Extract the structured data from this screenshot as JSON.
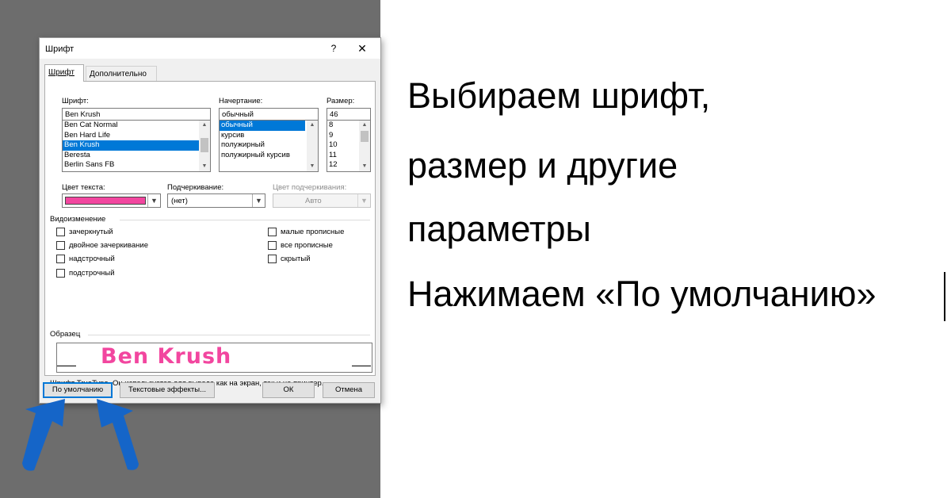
{
  "dialog": {
    "title": "Шрифт",
    "help": "?",
    "close": "✕",
    "tabs": [
      "Шрифт",
      "Дополнительно"
    ],
    "font": {
      "label": "Шрифт:",
      "value": "Ben Krush",
      "list": [
        "Ben Cat Normal",
        "Ben Hard Life",
        "Ben Krush",
        "Beresta",
        "Berlin Sans FB"
      ],
      "selected": "Ben Krush"
    },
    "style": {
      "label": "Начертание:",
      "value": "обычный",
      "list": [
        "обычный",
        "курсив",
        "полужирный",
        "полужирный курсив"
      ],
      "selected": "обычный"
    },
    "size": {
      "label": "Размер:",
      "value": "46",
      "list": [
        "8",
        "9",
        "10",
        "11",
        "12"
      ]
    },
    "text_color": {
      "label": "Цвет текста:",
      "color": "#f2469f"
    },
    "underline": {
      "label": "Подчеркивание:",
      "value": "(нет)"
    },
    "underline_color": {
      "label": "Цвет подчеркивания:",
      "value": "Авто"
    },
    "effects": {
      "label": "Видоизменение",
      "left": [
        "зачеркнутый",
        "двойное зачеркивание",
        "надстрочный",
        "подстрочный"
      ],
      "right": [
        "малые прописные",
        "все прописные",
        "скрытый"
      ]
    },
    "preview": {
      "label": "Образец",
      "text": "Ben Krush"
    },
    "note": "Шрифт TrueType. Он используется для вывода как на экран, так и на принтер.",
    "buttons": {
      "default": "По умолчанию",
      "effects": "Текстовые эффекты...",
      "ok": "ОК",
      "cancel": "Отмена"
    }
  },
  "caption": {
    "line1": "Выбираем шрифт,",
    "line2": "размер и другие",
    "line3": "параметры",
    "line4": "Нажимаем «По умолчанию»"
  },
  "colors": {
    "arrow": "#1565c8",
    "selection": "#0078d7",
    "left_background": "#6d6d6d"
  },
  "icons": [
    "up-arrow-icon",
    "up-arrow-icon"
  ]
}
